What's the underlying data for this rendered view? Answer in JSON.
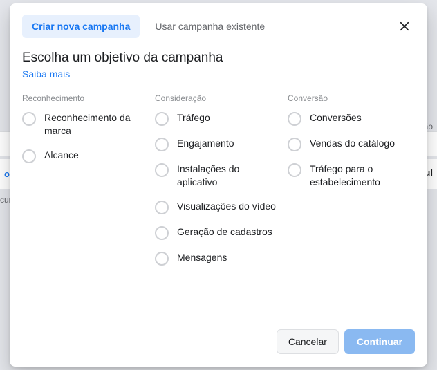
{
  "backdrop": {
    "blue_text": "o ↑",
    "right1": "ão",
    "right2": "sul",
    "cur": "cur"
  },
  "tabs": {
    "create": "Criar nova campanha",
    "existing": "Usar campanha existente"
  },
  "title": "Escolha um objetivo da campanha",
  "learn_more": "Saiba mais",
  "columns": [
    {
      "header": "Reconhecimento",
      "options": [
        "Reconhecimento da marca",
        "Alcance"
      ]
    },
    {
      "header": "Consideração",
      "options": [
        "Tráfego",
        "Engajamento",
        "Instalações do aplicativo",
        "Visualizações do vídeo",
        "Geração de cadastros",
        "Mensagens"
      ]
    },
    {
      "header": "Conversão",
      "options": [
        "Conversões",
        "Vendas do catálogo",
        "Tráfego para o estabelecimento"
      ]
    }
  ],
  "footer": {
    "cancel": "Cancelar",
    "continue": "Continuar"
  }
}
